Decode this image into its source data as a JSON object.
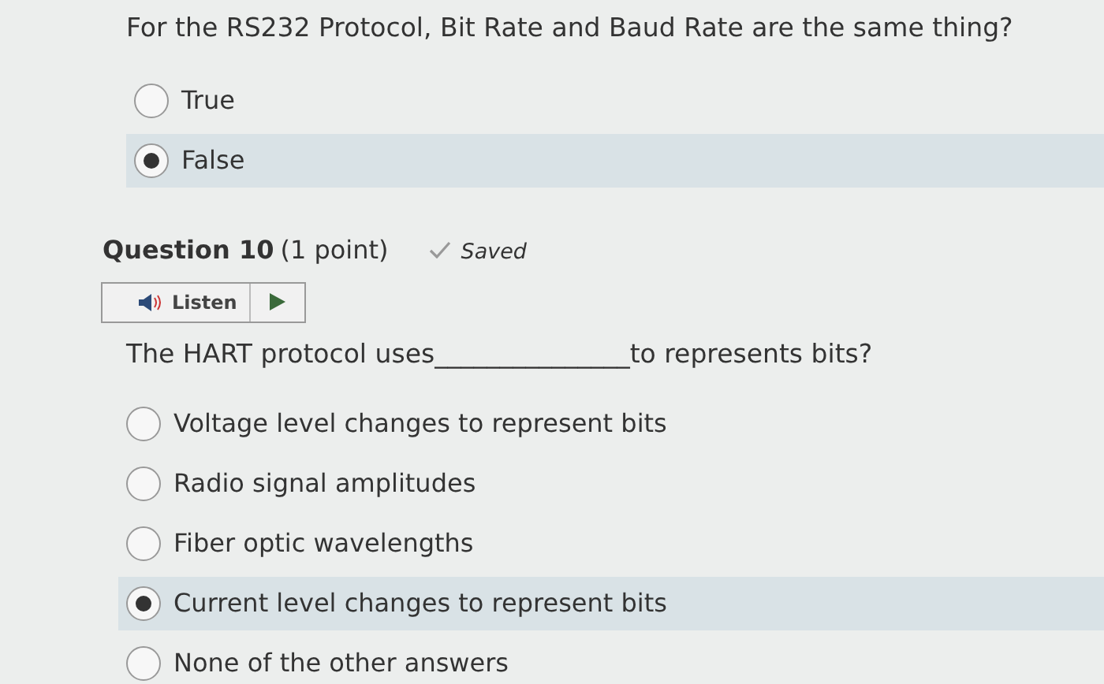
{
  "questions": [
    {
      "text": "For the RS232 Protocol,  Bit Rate and Baud Rate are the same thing?",
      "options": [
        {
          "label": "True",
          "selected": false
        },
        {
          "label": "False",
          "selected": true
        }
      ]
    },
    {
      "title": "Question 10",
      "points": "(1 point)",
      "status": "Saved",
      "listen": "Listen",
      "text": "The HART protocol uses_______________to represents bits?",
      "options": [
        {
          "label": "Voltage level changes to represent bits",
          "selected": false
        },
        {
          "label": "Radio signal amplitudes",
          "selected": false
        },
        {
          "label": "Fiber optic wavelengths",
          "selected": false
        },
        {
          "label": "Current level changes to represent bits",
          "selected": true
        },
        {
          "label": "None of the other answers",
          "selected": false
        }
      ]
    }
  ]
}
